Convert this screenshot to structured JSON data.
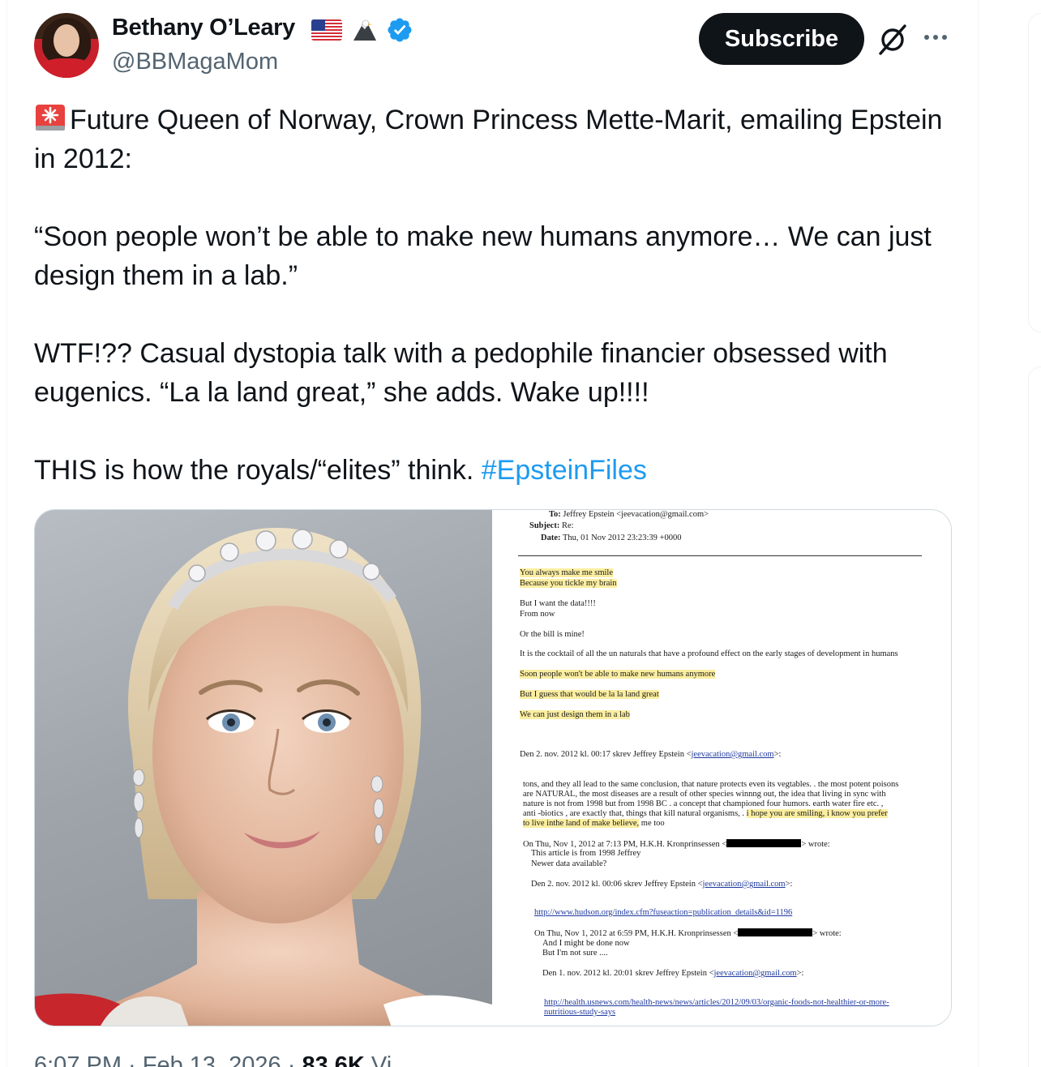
{
  "author": {
    "name": "Bethany O’Leary",
    "handle": "@BBMagaMom",
    "badges": [
      "us-flag-icon",
      "eagle-icon",
      "verified-icon"
    ]
  },
  "actions": {
    "subscribe_label": "Subscribe",
    "icons": [
      "grok-icon",
      "more-icon"
    ]
  },
  "tweet": {
    "paragraphs": [
      "Future Queen of Norway, Crown Princess Mette-Marit, emailing Epstein in 2012:",
      "“Soon people won’t be able to make new humans anymore… We can just design them in a lab.”",
      "WTF!?? Casual dystopia talk with a pedophile financier obsessed with eugenics. “La la land great,” she adds. Wake up!!!!",
      "THIS is how the royals/“elites” think."
    ],
    "hashtag": "#EpsteinFiles",
    "lead_icon": "siren-icon"
  },
  "document": {
    "to_label": "To:",
    "to_value": "Jeffrey Epstein <jeevacation@gmail.com>",
    "subject_label": "Subject:",
    "subject_value": "Re:",
    "date_label": "Date:",
    "date_value": "Thu, 01 Nov 2012 23:23:39 +0000",
    "lines": {
      "l1": "You always make me smile",
      "l2": "Because you tickle my brain",
      "l3": "But I want the data!!!!",
      "l4": "From now",
      "l5": "Or the bill is mine!",
      "l6": "It is the cocktail of all the un naturals that have a profound effect on the early stages of development in humans",
      "l7": "Soon people won't be able to make new humans anymore",
      "l8": "But I guess that would be la la land great",
      "l9": "We can just design them in a lab",
      "l10_pre": "Den 2. nov. 2012 kl. 00:17 skrev Jeffrey Epstein <",
      "l10_link": "jeevacation@gmail.com",
      "l10_post": ">:",
      "p1": "tons, and they all lead to the same conclusion, that nature protects even its vegtables.  . the most potent poisons",
      "p2": "are NATURAL,   the most diseases are a result of other species winnng out, the idea that living in sync with",
      "p3": "nature is not from 1998 but from 1998 BC   .  a concept that championed four humors.  earth water fire etc.   ,",
      "p4_pre": "anti -biotics , are exactly that,  things that kill natural organisms,   .  ",
      "p4_mark": "i hope you are smiling,   i know you prefer",
      "p5_mark": "to live inthe land of make believe,",
      "p5_post": "   me too",
      "q1_pre": "On Thu, Nov 1, 2012 at 7:13 PM, H.K.H. Kronprinsessen <",
      "q1_post": "> wrote:",
      "q2": "This article is from 1998 Jeffrey",
      "q3": "Newer data available?",
      "q4_pre": "Den 2. nov. 2012 kl. 00:06 skrev Jeffrey Epstein <",
      "q4_link": "jeevacation@gmail.com",
      "q4_post": ">:",
      "q5_link": "http://www.hudson.org/index.cfm?fuseaction=publication_details&id=1196",
      "r1_pre": "On Thu, Nov 1, 2012 at 6:59 PM, H.K.H. Kronprinsessen <",
      "r1_post": "> wrote:",
      "r2": "And I might be done now",
      "r3": "But I'm not sure ....",
      "r4_pre": "Den 1. nov. 2012 kl. 20:01 skrev Jeffrey Epstein <",
      "r4_link": "jeevacation@gmail.com",
      "r4_post": ">:",
      "r5_link": "http://health.usnews.com/health-news/news/articles/2012/09/03/organic-foods-not-healthier-or-more-",
      "r6_link": "nutritious-study-says"
    }
  },
  "footer": {
    "time": "6:07 PM · Feb 13, 2026 · ",
    "views": "83.6K",
    "views_label": " Vi"
  },
  "colors": {
    "accent": "#1d9bf0",
    "text": "#0f1419",
    "muted": "#536471",
    "highlight": "#fbeea0"
  }
}
